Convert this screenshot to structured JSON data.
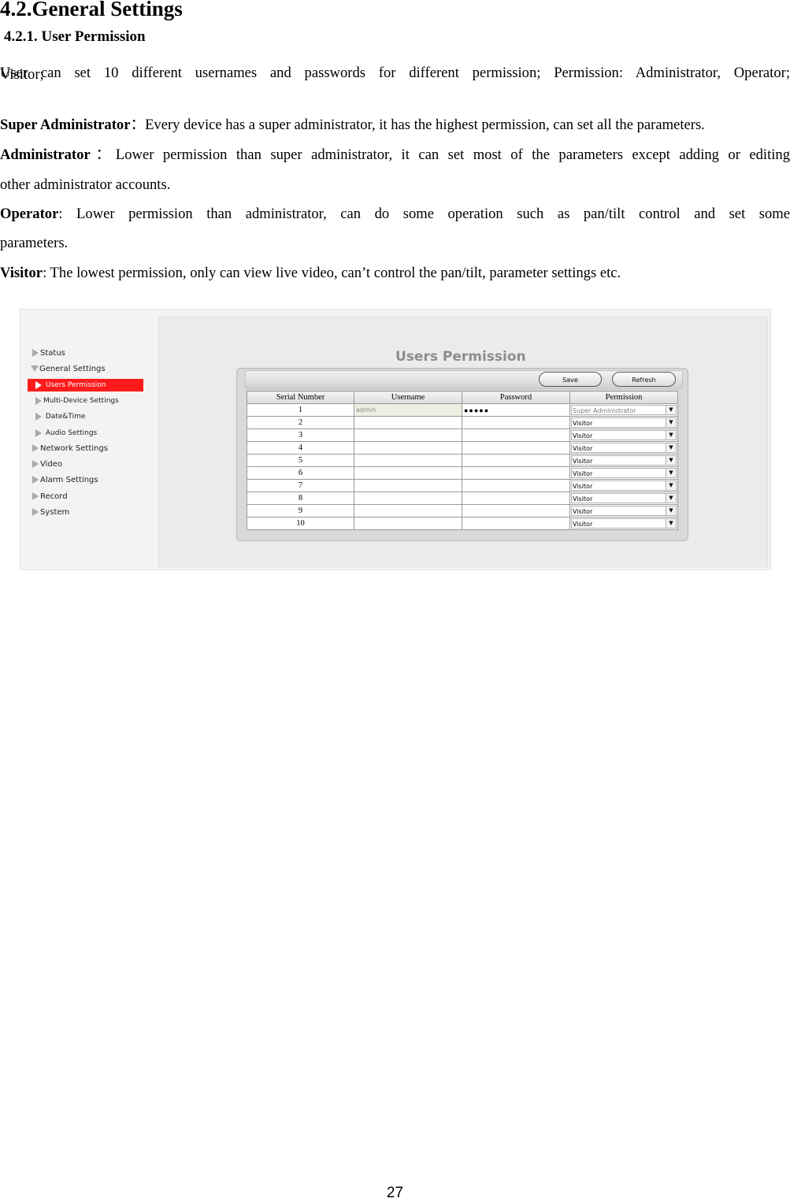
{
  "heading": "4.2.General Settings",
  "subheading": "4.2.1. User Permission",
  "intro_line1": "User can set 10 different usernames and passwords for different permission; Permission: Administrator, Operator;",
  "intro_line2": "Visitor;",
  "super_admin_label": "Super Administrator",
  "super_admin_sep": "：",
  "super_admin_text": "Every device has a super administrator, it has the highest permission, can set all the parameters.",
  "admin_label": "Administrator",
  "admin_sep": "：",
  "admin_text_line1": "Lower permission than super administrator, it can set most of the parameters except adding or editing",
  "admin_text_line2": "other administrator accounts.",
  "operator_label": "Operator",
  "operator_text_line1": ": Lower permission than administrator, can do some operation such as pan/tilt control and set some",
  "operator_text_line2": "parameters.",
  "visitor_label": "Visitor",
  "visitor_text": ": The lowest permission, only can view live video, can’t control the pan/tilt, parameter settings etc.",
  "page_number": "27",
  "screenshot": {
    "sidebar": [
      {
        "label": "Status"
      },
      {
        "label": "General Settings"
      },
      {
        "label": "Users Permission"
      },
      {
        "label": "Multi-Device Settings"
      },
      {
        "label": "Date&Time"
      },
      {
        "label": "Audio Settings"
      },
      {
        "label": "Network Settings"
      },
      {
        "label": "Video"
      },
      {
        "label": "Alarm Settings"
      },
      {
        "label": "Record"
      },
      {
        "label": "System"
      }
    ],
    "title": "Users Permission",
    "save_label": "Save",
    "refresh_label": "Refresh",
    "columns": [
      "Serial Number",
      "Username",
      "Password",
      "Permission"
    ],
    "rows": [
      {
        "serial": "1",
        "username": "admin",
        "password": "●●●●●",
        "permission": "Super Administrator"
      },
      {
        "serial": "2",
        "username": "",
        "password": "",
        "permission": "Visitor"
      },
      {
        "serial": "3",
        "username": "",
        "password": "",
        "permission": "Visitor"
      },
      {
        "serial": "4",
        "username": "",
        "password": "",
        "permission": "Visitor"
      },
      {
        "serial": "5",
        "username": "",
        "password": "",
        "permission": "Visitor"
      },
      {
        "serial": "6",
        "username": "",
        "password": "",
        "permission": "Visitor"
      },
      {
        "serial": "7",
        "username": "",
        "password": "",
        "permission": "Visitor"
      },
      {
        "serial": "8",
        "username": "",
        "password": "",
        "permission": "Visitor"
      },
      {
        "serial": "9",
        "username": "",
        "password": "",
        "permission": "Visitor"
      },
      {
        "serial": "10",
        "username": "",
        "password": "",
        "permission": "Visitor"
      }
    ],
    "colors": {
      "active_nav": "#ff1b1b",
      "title": "#8c8c8c"
    }
  }
}
